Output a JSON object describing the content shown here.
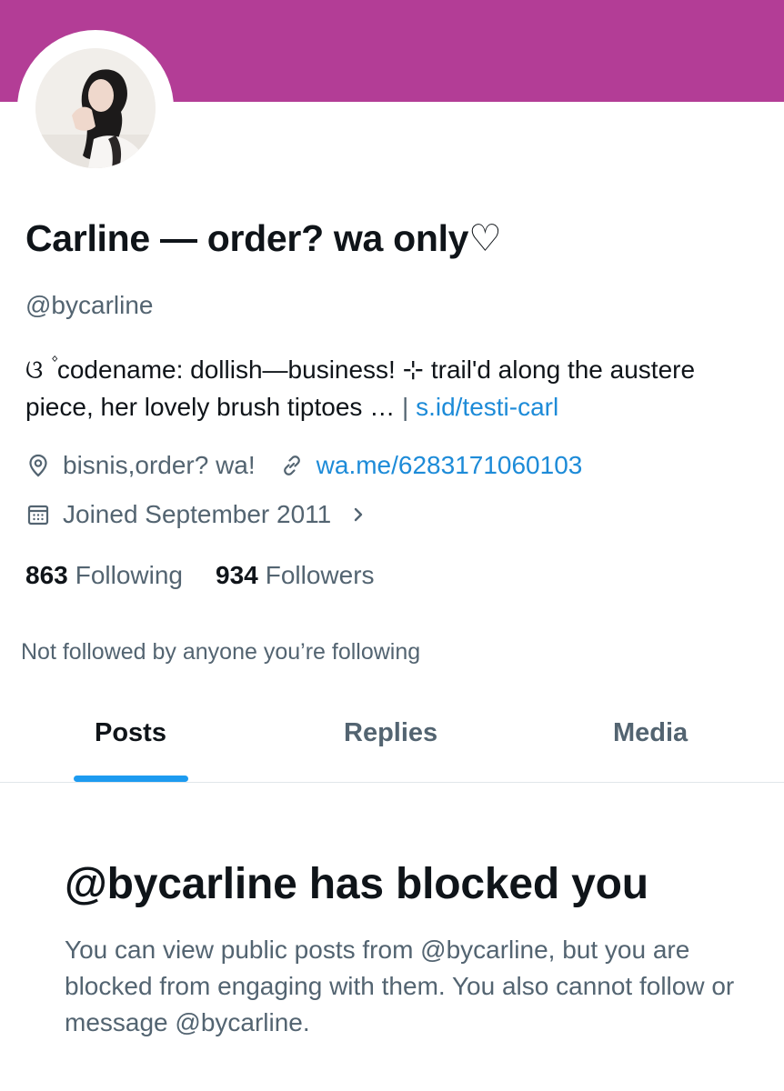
{
  "profile": {
    "display_name": "Carline — order? wa only♡",
    "handle": "@bycarline",
    "bio": {
      "text": "ଓ ۫ codename:  dollish—business!  ⊹  trail'd along the austere piece, her lovely brush tiptoes …",
      "separator": "|",
      "link": "s.id/testi-carl"
    },
    "location": "bisnis,order? wa!",
    "website": "wa.me/6283171060103",
    "joined": "Joined September 2011",
    "following_count": "863",
    "following_label": "Following",
    "followers_count": "934",
    "followers_label": "Followers",
    "not_followed_text": "Not followed by anyone you’re following",
    "banner_color": "#b33d96",
    "link_color": "#1d8bd8"
  },
  "tabs": [
    {
      "label": "Posts",
      "active": true
    },
    {
      "label": "Replies",
      "active": false
    },
    {
      "label": "Media",
      "active": false
    }
  ],
  "blocked": {
    "title": "@bycarline has blocked you",
    "description": "You can view public posts from @bycarline, but you are blocked from engaging with them. You also cannot follow or message @bycarline."
  },
  "icons": {
    "location": "location-pin-icon",
    "website": "link-icon",
    "joined": "calendar-icon",
    "joined_more": "chevron-right-icon"
  }
}
